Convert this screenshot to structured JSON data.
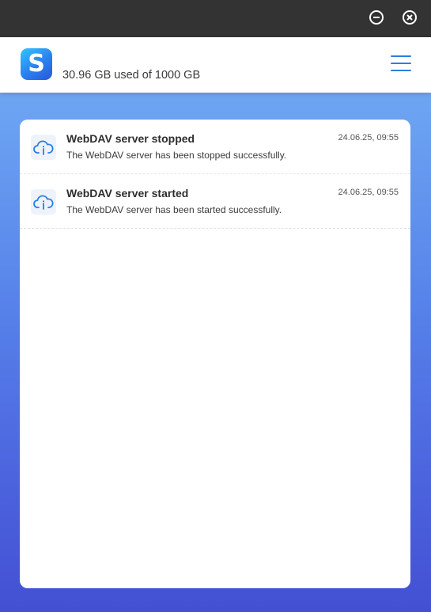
{
  "window": {
    "minimize_icon": "minus-circle-icon",
    "close_icon": "x-circle-icon"
  },
  "header": {
    "logo_letter": "S",
    "storage_text": "30.96 GB used of 1000 GB",
    "menu_icon": "hamburger-menu-icon"
  },
  "colors": {
    "accent": "#2a7fe0",
    "titlebar": "#333333",
    "background_top": "#6ea6f3",
    "background_bottom": "#4350d2"
  },
  "notifications": [
    {
      "icon": "cloud-info-icon",
      "title": "WebDAV server stopped",
      "text": "The WebDAV server has been stopped successfully.",
      "time": "24.06.25, 09:55"
    },
    {
      "icon": "cloud-info-icon",
      "title": "WebDAV server started",
      "text": "The WebDAV server has been started successfully.",
      "time": "24.06.25, 09:55"
    }
  ]
}
